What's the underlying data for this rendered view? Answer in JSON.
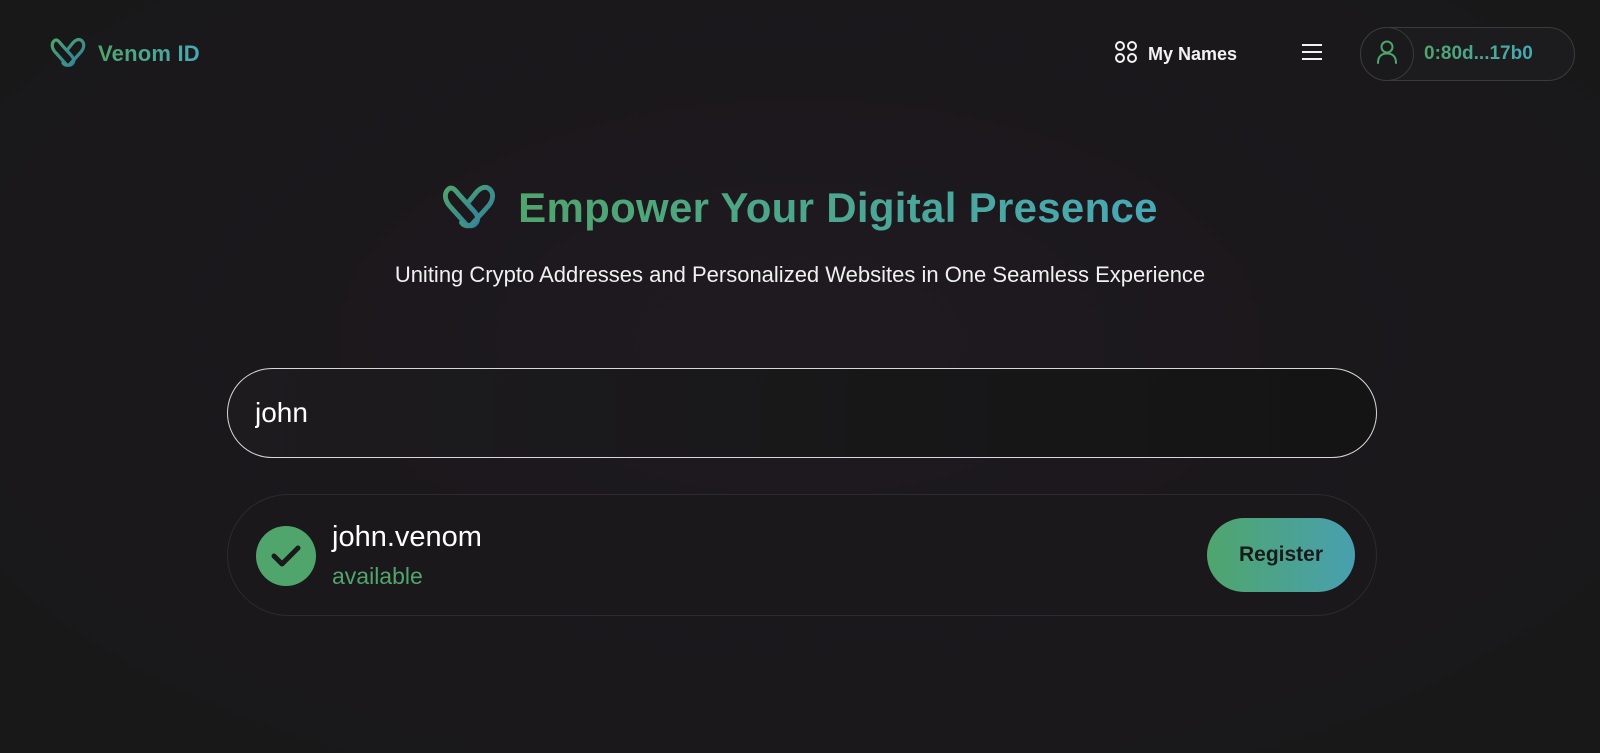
{
  "header": {
    "brand_name": "Venom ID",
    "my_names_label": "My Names",
    "wallet_address": "0:80d...17b0"
  },
  "hero": {
    "title": "Empower Your Digital Presence",
    "subtitle": "Uniting Crypto Addresses and Personalized Websites in One Seamless Experience"
  },
  "search": {
    "value": "john"
  },
  "result": {
    "name": "john.venom",
    "status": "available",
    "register_label": "Register"
  },
  "colors": {
    "accent_green": "#4fa56c",
    "accent_teal": "#48a8b6",
    "background": "#1b181c"
  },
  "icons": {
    "logo": "venom-logo-icon",
    "my_names": "grid-icon",
    "menu": "hamburger-icon",
    "wallet": "user-icon",
    "status": "check-icon"
  }
}
